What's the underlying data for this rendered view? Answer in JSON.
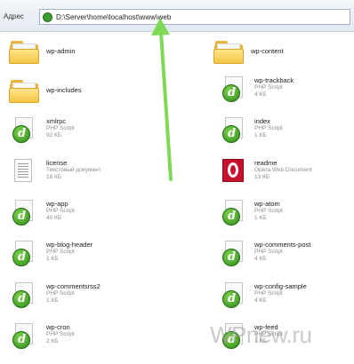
{
  "address_bar": {
    "label": "Адрес",
    "path": "D:\\Server\\home\\localhost\\www\\web"
  },
  "files": [
    {
      "name": "wp-admin",
      "icon": "folder-icon"
    },
    {
      "name": "wp-content",
      "icon": "folder-icon"
    },
    {
      "name": "wp-includes",
      "icon": "folder-icon"
    },
    {
      "name": "wp-trackback",
      "icon": "dreamweaver-php-icon",
      "type": "PHP Script",
      "size": "4 КБ"
    },
    {
      "name": "xmlrpc",
      "icon": "dreamweaver-php-icon",
      "type": "PHP Script",
      "size": "92 КБ"
    },
    {
      "name": "index",
      "icon": "dreamweaver-php-icon",
      "type": "PHP Script",
      "size": "1 КБ"
    },
    {
      "name": "license",
      "icon": "text-document-icon",
      "type": "Текстовый документ",
      "size": "18 КБ"
    },
    {
      "name": "readme",
      "icon": "opera-document-icon",
      "type": "Opera Web Document",
      "size": "13 КБ"
    },
    {
      "name": "wp-app",
      "icon": "dreamweaver-php-icon",
      "type": "PHP Script",
      "size": "40 КБ"
    },
    {
      "name": "wp-atom",
      "icon": "dreamweaver-php-icon",
      "type": "PHP Script",
      "size": "1 КБ"
    },
    {
      "name": "wp-blog-header",
      "icon": "dreamweaver-php-icon",
      "type": "PHP Script",
      "size": "1 КБ"
    },
    {
      "name": "wp-comments-post",
      "icon": "dreamweaver-php-icon",
      "type": "PHP Script",
      "size": "4 КБ"
    },
    {
      "name": "wp-commentsrss2",
      "icon": "dreamweaver-php-icon",
      "type": "PHP Script",
      "size": "1 КБ"
    },
    {
      "name": "wp-config-sample",
      "icon": "dreamweaver-php-icon",
      "type": "PHP Script",
      "size": "4 КБ"
    },
    {
      "name": "wp-cron",
      "icon": "dreamweaver-php-icon",
      "type": "PHP Script",
      "size": "2 КБ"
    },
    {
      "name": "wp-feed",
      "icon": "dreamweaver-php-icon",
      "type": "PHP Script",
      "size": "1 КБ"
    }
  ],
  "watermark": "WPnew.ru",
  "colors": {
    "annotation_arrow": "#7ed957",
    "folder": "#f5c545",
    "php_badge": "#3f9b2f",
    "opera": "#c8102e"
  }
}
